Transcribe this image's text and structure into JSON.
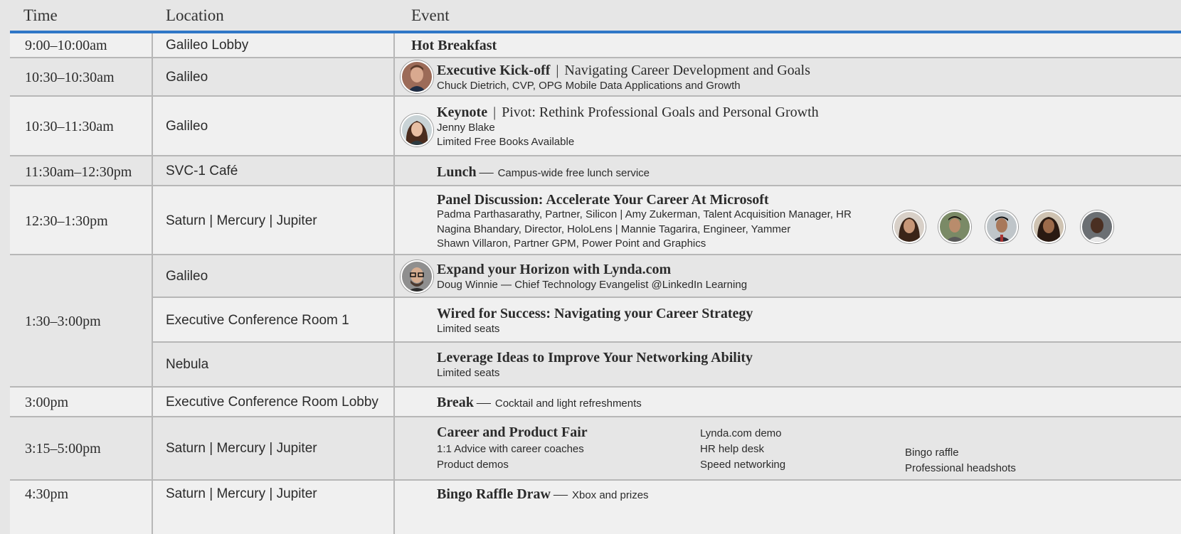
{
  "header": {
    "time": "Time",
    "location": "Location",
    "event": "Event"
  },
  "colors": {
    "accent_rule": "#2f77c7",
    "grid_line": "#b7b7b7",
    "row_light": "#f0f0f0",
    "row_dark": "#e6e6e6"
  },
  "rows": [
    {
      "time": "9:00–10:00am",
      "location": "Galileo Lobby",
      "title": "Hot Breakfast"
    },
    {
      "time": "10:30–10:30am",
      "location": "Galileo",
      "title": "Executive Kick-off",
      "sep": "|",
      "subtitle": "Navigating Career Development and Goals",
      "lines": [
        "Chuck Dietrich, CVP, OPG Mobile Data Applications and Growth"
      ]
    },
    {
      "time": "10:30–11:30am",
      "location": "Galileo",
      "title": "Keynote",
      "sep": "|",
      "subtitle": "Pivot: Rethink Professional Goals and Personal Growth",
      "lines": [
        "Jenny Blake",
        "Limited Free Books Available"
      ]
    },
    {
      "time": "11:30am–12:30pm",
      "location": "SVC-1 Café",
      "title": "Lunch",
      "dash": "—",
      "note": "Campus-wide free lunch service"
    },
    {
      "time": "12:30–1:30pm",
      "location": "Saturn | Mercury | Jupiter",
      "title": "Panel Discussion: Accelerate Your Career At Microsoft",
      "lines": [
        "Padma Parthasarathy, Partner, Silicon | Amy Zukerman, Talent Acquisition Manager, HR",
        "Nagina Bhandary, Director, HoloLens | Mannie Tagarira, Engineer, Yammer",
        "Shawn Villaron, Partner GPM, Power Point and Graphics"
      ]
    },
    {
      "time": "1:30–3:00pm",
      "sessions": [
        {
          "location": "Galileo",
          "title": "Expand your Horizon with Lynda.com",
          "lines": [
            "Doug Winnie — Chief Technology Evangelist @LinkedIn Learning"
          ]
        },
        {
          "location": "Executive Conference Room 1",
          "title": "Wired for Success: Navigating your Career Strategy",
          "lines": [
            "Limited seats"
          ]
        },
        {
          "location": "Nebula",
          "title": "Leverage Ideas to Improve Your Networking Ability",
          "lines": [
            "Limited seats"
          ]
        }
      ]
    },
    {
      "time": "3:00pm",
      "location": "Executive Conference Room Lobby",
      "title": "Break",
      "dash": "—",
      "note": "Cocktail and light refreshments"
    },
    {
      "time": "3:15–5:00pm",
      "location": "Saturn | Mercury | Jupiter",
      "title": "Career and Product Fair",
      "col1": [
        "1:1 Advice with career coaches",
        "Product demos"
      ],
      "col2": [
        "Lynda.com demo",
        "HR help desk",
        "Speed networking"
      ],
      "col3": [
        "Bingo raffle",
        "Professional headshots"
      ]
    },
    {
      "time": "4:30pm",
      "location": "Saturn | Mercury | Jupiter",
      "title": "Bingo Raffle Draw",
      "dash": "—",
      "note": "Xbox and prizes"
    }
  ]
}
